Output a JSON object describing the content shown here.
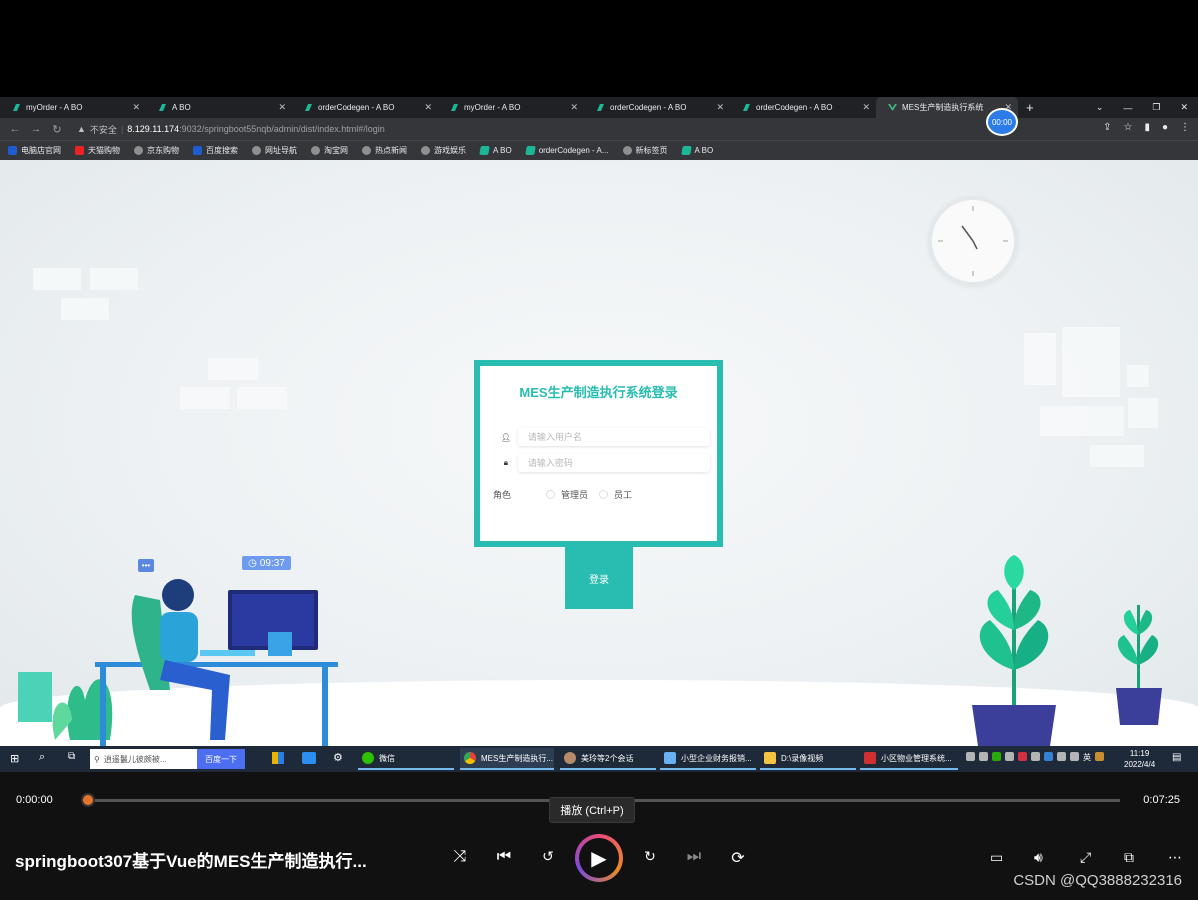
{
  "browser": {
    "tabs": [
      {
        "title": "myOrder - A BO",
        "active": false
      },
      {
        "title": "A BO",
        "active": false
      },
      {
        "title": "orderCodegen - A BO",
        "active": false
      },
      {
        "title": "myOrder - A BO",
        "active": false
      },
      {
        "title": "orderCodegen - A BO",
        "active": false
      },
      {
        "title": "orderCodegen - A BO",
        "active": false
      },
      {
        "title": "MES生产制造执行系统",
        "active": true
      }
    ],
    "new_tab": "+",
    "insecure_label": "不安全",
    "url_host": "8.129.11.174",
    "url_path": ":9032/springboot55nqb/admin/dist/index.html#/login",
    "recorder_time": "00:00",
    "bookmarks": [
      "电脑店官网",
      "天猫购物",
      "京东购物",
      "百度搜索",
      "网址导航",
      "淘宝网",
      "热点新闻",
      "游戏娱乐",
      "A BO",
      "orderCodegen - A...",
      "新标签页",
      "A BO"
    ]
  },
  "login": {
    "title": "MES生产制造执行系统登录",
    "username_placeholder": "请输入用户名",
    "password_placeholder": "请输入密码",
    "role_label": "角色",
    "roles": [
      "管理员",
      "员工"
    ],
    "submit": "登录"
  },
  "illustration": {
    "clock_badge": "09:37",
    "chat_badge": "•••"
  },
  "taskbar": {
    "search_placeholder": "逍遥鬣儿彼颇被...",
    "search_button": "百度一下",
    "apps": [
      "微信",
      "MES生产制造执行...",
      "美玲等2个会话",
      "小型企业财务报销...",
      "D:\\录像视频",
      "小区物业管理系统..."
    ],
    "tray_lang": "英",
    "time": "11:19",
    "date": "2022/4/4"
  },
  "player": {
    "current_time": "0:00:00",
    "total_time": "0:07:25",
    "progress": 0,
    "tooltip": "播放 (Ctrl+P)",
    "title": "springboot307基于Vue的MES生产制造执行...",
    "watermark": "CSDN @QQ3888232316"
  },
  "colors": {
    "accent": "#28bdb0",
    "progress_knob": "#e8742c"
  }
}
